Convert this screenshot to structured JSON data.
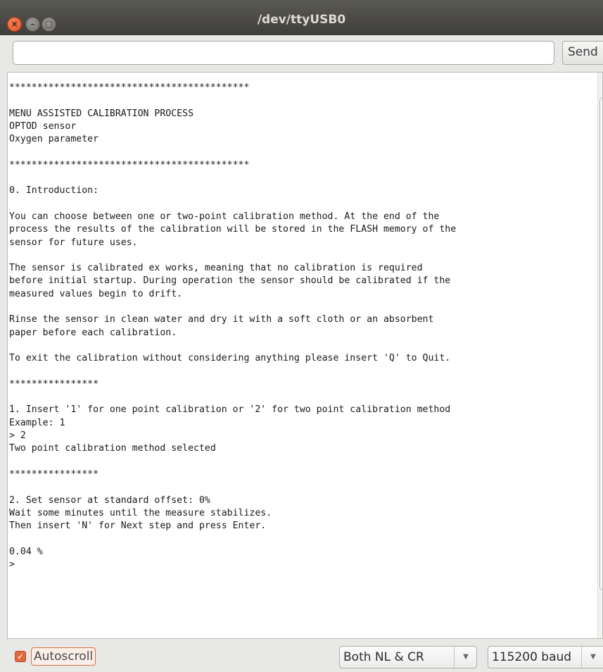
{
  "window": {
    "title": "/dev/ttyUSB0",
    "close_glyph": "×",
    "min_glyph": "–",
    "max_glyph": "□"
  },
  "send": {
    "input_value": "",
    "button_label": "Send"
  },
  "console": {
    "text": "*******************************************\n\nMENU ASSISTED CALIBRATION PROCESS\nOPTOD sensor\nOxygen parameter\n\n*******************************************\n\n0. Introduction:\n\nYou can choose between one or two-point calibration method. At the end of the\nprocess the results of the calibration will be stored in the FLASH memory of the\nsensor for future uses.\n\nThe sensor is calibrated ex works, meaning that no calibration is required\nbefore initial startup. During operation the sensor should be calibrated if the\nmeasured values begin to drift.\n\nRinse the sensor in clean water and dry it with a soft cloth or an absorbent\npaper before each calibration.\n\nTo exit the calibration without considering anything please insert 'Q' to Quit.\n\n****************\n\n1. Insert '1' for one point calibration or '2' for two point calibration method\nExample: 1\n> 2\nTwo point calibration method selected\n\n****************\n\n2. Set sensor at standard offset: 0%\nWait some minutes until the measure stabilizes.\nThen insert 'N' for Next step and press Enter.\n\n0.04 %\n>"
  },
  "bottom": {
    "autoscroll_label": "Autoscroll",
    "autoscroll_checked": true,
    "check_glyph": "✓",
    "line_ending": "Both NL & CR",
    "baud_rate": "115200 baud",
    "dropdown_glyph": "▼"
  },
  "colors": {
    "accent": "#e06a3d",
    "titlebar": "#4a4945"
  }
}
